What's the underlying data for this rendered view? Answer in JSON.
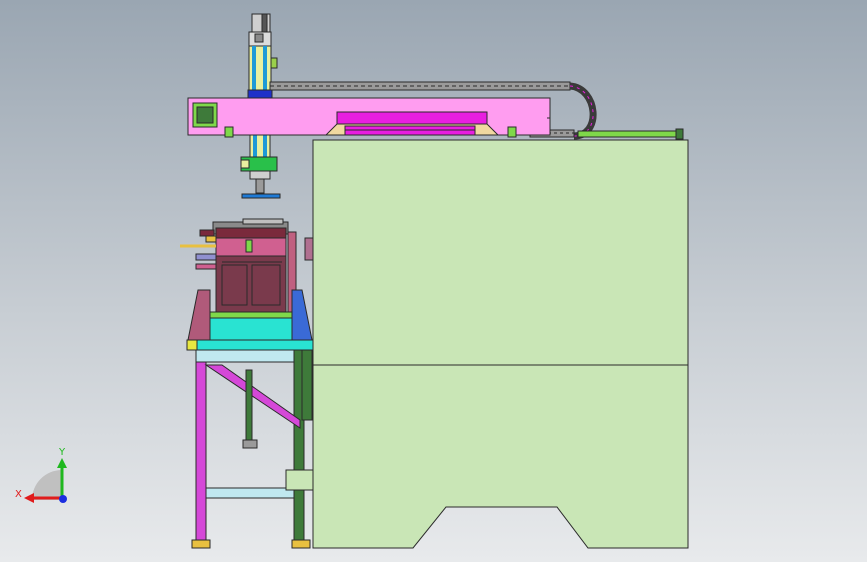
{
  "triad": {
    "x_label": "X",
    "y_label": "Y",
    "x_color": "#e01b1b",
    "y_color": "#1fb81f",
    "z_color": "#1a2ee0"
  },
  "colors": {
    "cabinet": "#c9e6b6",
    "gantry_beam": "#ff9df0",
    "magenta": "#e81ee0",
    "cyan": "#29e3d2",
    "table_frame": "#d548d8",
    "dark_green": "#3e7a3a",
    "lime": "#7fd84a",
    "maroon": "#7a2a3c",
    "chain": "#3a3a3a",
    "outline": "#2a2a2a"
  }
}
